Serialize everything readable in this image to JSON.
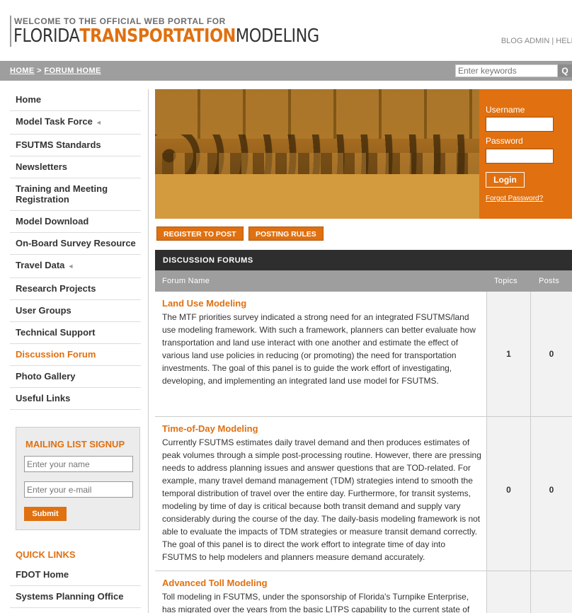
{
  "header": {
    "welcome": "WELCOME TO THE OFFICIAL WEB PORTAL FOR",
    "logo_part1": "FLORIDA",
    "logo_part2": "TRANSPORTATION",
    "logo_part3": "MODELING",
    "toplinks": "BLOG ADMIN | HELP"
  },
  "breadcrumb": {
    "home": "HOME",
    "sep": " > ",
    "forum_home": "FORUM HOME"
  },
  "search": {
    "placeholder": "Enter keywords",
    "button_icon": "search-icon",
    "button_glyph": "Q"
  },
  "nav": {
    "items": [
      {
        "label": "Home"
      },
      {
        "label": "Model Task Force",
        "arrow": "◄"
      },
      {
        "label": "FSUTMS Standards"
      },
      {
        "label": "Newsletters"
      },
      {
        "label": "Training and Meeting Registration"
      },
      {
        "label": "Model Download"
      },
      {
        "label": "On-Board Survey Resource"
      },
      {
        "label": "Travel Data",
        "arrow": "◄"
      },
      {
        "label": "Research Projects"
      },
      {
        "label": "User Groups"
      },
      {
        "label": "Technical Support"
      },
      {
        "label": "Discussion Forum",
        "active": true
      },
      {
        "label": "Photo Gallery"
      },
      {
        "label": "Useful Links"
      }
    ]
  },
  "mailing": {
    "title": "MAILING LIST SIGNUP",
    "name_placeholder": "Enter your name",
    "email_placeholder": "Enter your e-mail",
    "submit": "Submit"
  },
  "quicklinks": {
    "title": "QUICK LINKS",
    "items": [
      "FDOT Home",
      "Systems Planning Office"
    ]
  },
  "login": {
    "username_label": "Username",
    "password_label": "Password",
    "button": "Login",
    "forgot": "Forgot Password?"
  },
  "actions": {
    "register": "REGISTER TO POST",
    "rules": "POSTING RULES"
  },
  "forum": {
    "title": "DISCUSSION FORUMS",
    "col_name": "Forum Name",
    "col_topics": "Topics",
    "col_posts": "Posts",
    "rows": [
      {
        "title": "Land Use Modeling",
        "desc": "The MTF priorities survey indicated a strong need for an integrated FSUTMS/land use modeling framework. With such a framework, planners can better evaluate how transportation and land use interact with one another and estimate the effect of various land use policies in reducing (or promoting) the need for transportation investments. The goal of this panel is to guide the work effort of investigating, developing, and implementing an integrated land use model for FSUTMS.",
        "topics": "1",
        "posts": "0"
      },
      {
        "title": "Time-of-Day Modeling",
        "desc": "Currently FSUTMS estimates daily travel demand and then produces estimates of peak volumes through a simple post-processing routine. However, there are pressing needs to address planning issues and answer questions that are TOD-related. For example, many travel demand management (TDM) strategies intend to smooth the temporal distribution of travel over the entire day. Furthermore, for transit systems, modeling by time of day is critical because both transit demand and supply vary considerably during the course of the day. The daily-basis modeling framework is not able to evaluate the impacts of TDM strategies or measure transit demand correctly. The goal of this panel is to direct the work effort to integrate time of day into FSUTMS to help modelers and planners measure demand accurately.",
        "topics": "0",
        "posts": "0"
      },
      {
        "title": "Advanced Toll Modeling",
        "desc": "Toll modeling in FSUTMS, under the sponsorship of Florida's Turnpike Enterprise, has migrated over the years from the basic LITPS capability to the current state of",
        "topics": "",
        "posts": ""
      }
    ]
  }
}
